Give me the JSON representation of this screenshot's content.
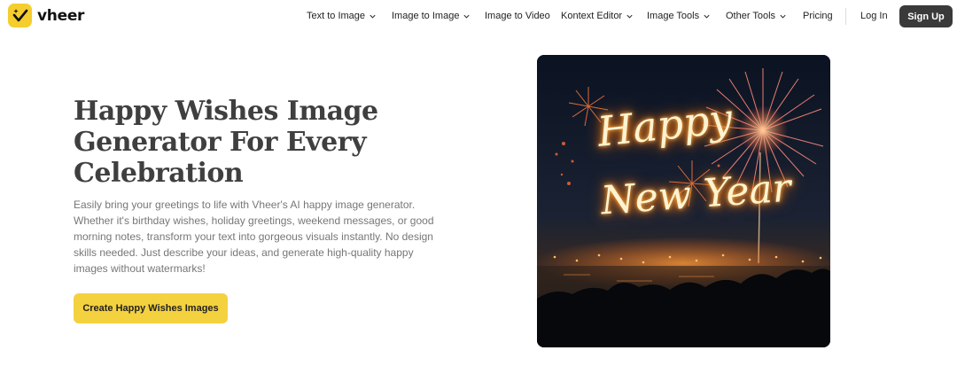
{
  "brand": {
    "name": "vheer",
    "accent": "#f5cd2c"
  },
  "nav": {
    "items": [
      {
        "label": "Text to Image",
        "dropdown": true
      },
      {
        "label": "Image to Image",
        "dropdown": true
      },
      {
        "label": "Image to Video",
        "dropdown": false
      },
      {
        "label": "Kontext Editor",
        "dropdown": true
      },
      {
        "label": "Image Tools",
        "dropdown": true
      },
      {
        "label": "Other Tools",
        "dropdown": true
      },
      {
        "label": "Pricing",
        "dropdown": false
      }
    ],
    "login": "Log In",
    "signup": "Sign Up"
  },
  "hero": {
    "title": "Happy Wishes Image Generator For Every Celebration",
    "description": "Easily bring your greetings to life with Vheer's AI happy image generator. Whether it's birthday wishes, holiday greetings, weekend messages, or good morning notes, transform your text into gorgeous visuals instantly. No design skills needed. Just describe your ideas, and generate high-quality happy images without watermarks!",
    "cta": "Create Happy Wishes Images",
    "image_text_line1": "Happy",
    "image_text_line2": "New Year"
  }
}
